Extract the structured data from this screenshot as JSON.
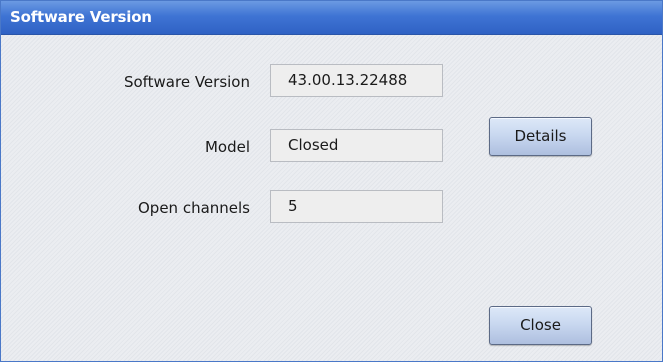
{
  "window": {
    "title": "Software Version"
  },
  "fields": [
    {
      "label": "Software Version",
      "value": "43.00.13.22488"
    },
    {
      "label": "Model",
      "value": "Closed"
    },
    {
      "label": "Open channels",
      "value": "5"
    }
  ],
  "buttons": {
    "details_label": "Details",
    "close_label": "Close"
  },
  "colors": {
    "titlebar": "#3f74d4",
    "dialog_background": "#ebedf1",
    "button_face": "#c9d8f0"
  }
}
